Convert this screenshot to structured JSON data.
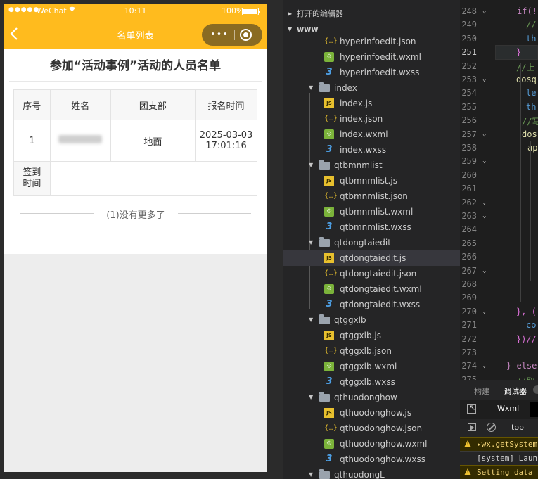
{
  "statusbar": {
    "signal": "●●●●●",
    "carrier": "WeChat",
    "wifi_icon": "wifi-icon",
    "time": "10:11",
    "battery_pct": "100%"
  },
  "navbar": {
    "back_glyph": "‹",
    "title": "名单列表",
    "more_glyph": "•••"
  },
  "page": {
    "heading": "参加“活动事例”活动的人员名单",
    "table": {
      "headers": [
        "序号",
        "姓名",
        "团支部",
        "报名时间"
      ],
      "rows": [
        {
          "index": "1",
          "branch": "地面",
          "time_line1": "2025-03-03",
          "time_line2": "17:01:16"
        }
      ],
      "signin_label_line1": "签到",
      "signin_label_line2": "时间"
    },
    "no_more": "(1)没有更多了"
  },
  "tree": {
    "section_open_editors": "打开的编辑器",
    "section_root": "www",
    "items": [
      {
        "type": "wxml-icon",
        "name": "hyperinfoedit.json",
        "kind": "json"
      },
      {
        "type": "wxml",
        "name": "hyperinfoedit.wxml",
        "kind": "wxml"
      },
      {
        "type": "wxss",
        "name": "hyperinfoedit.wxss",
        "kind": "wxss"
      },
      {
        "type": "folder",
        "name": "index",
        "kind": "folder"
      },
      {
        "type": "js",
        "name": "index.js",
        "kind": "js"
      },
      {
        "type": "json",
        "name": "index.json",
        "kind": "json"
      },
      {
        "type": "wxml",
        "name": "index.wxml",
        "kind": "wxml"
      },
      {
        "type": "wxss",
        "name": "index.wxss",
        "kind": "wxss"
      },
      {
        "type": "folder",
        "name": "qtbmnmlist",
        "kind": "folder"
      },
      {
        "type": "js",
        "name": "qtbmnmlist.js",
        "kind": "js"
      },
      {
        "type": "json",
        "name": "qtbmnmlist.json",
        "kind": "json"
      },
      {
        "type": "wxml",
        "name": "qtbmnmlist.wxml",
        "kind": "wxml"
      },
      {
        "type": "wxss",
        "name": "qtbmnmlist.wxss",
        "kind": "wxss"
      },
      {
        "type": "folder",
        "name": "qtdongtaiedit",
        "kind": "folder"
      },
      {
        "type": "js",
        "name": "qtdongtaiedit.js",
        "kind": "js"
      },
      {
        "type": "json",
        "name": "qtdongtaiedit.json",
        "kind": "json"
      },
      {
        "type": "wxml",
        "name": "qtdongtaiedit.wxml",
        "kind": "wxml"
      },
      {
        "type": "wxss",
        "name": "qtdongtaiedit.wxss",
        "kind": "wxss"
      },
      {
        "type": "folder",
        "name": "qtggxlb",
        "kind": "folder"
      },
      {
        "type": "js",
        "name": "qtggxlb.js",
        "kind": "js"
      },
      {
        "type": "json",
        "name": "qtggxlb.json",
        "kind": "json"
      },
      {
        "type": "wxml",
        "name": "qtggxlb.wxml",
        "kind": "wxml"
      },
      {
        "type": "wxss",
        "name": "qtggxlb.wxss",
        "kind": "wxss"
      },
      {
        "type": "folder",
        "name": "qthuodonghow",
        "kind": "folder"
      },
      {
        "type": "js",
        "name": "qthuodonghow.js",
        "kind": "js"
      },
      {
        "type": "json",
        "name": "qthuodonghow.json",
        "kind": "json"
      },
      {
        "type": "wxml",
        "name": "qthuodonghow.wxml",
        "kind": "wxml"
      },
      {
        "type": "wxss",
        "name": "qthuodonghow.wxss",
        "kind": "wxss"
      },
      {
        "type": "folder",
        "name": "qthuodongL",
        "kind": "folder"
      }
    ],
    "selected": "qtdongtaiedit.js"
  },
  "editor": {
    "lines": [
      "248",
      "249",
      "250",
      "251",
      "252",
      "253",
      "254",
      "255",
      "256",
      "257",
      "258",
      "259",
      "260",
      "261",
      "262",
      "263",
      "264",
      "265",
      "266",
      "267",
      "268",
      "269",
      "270",
      "271",
      "272",
      "273",
      "274",
      "275"
    ],
    "current_line": "251",
    "code": {
      "l248": "if(!",
      "l249": "//",
      "l250": "th",
      "l251": "}",
      "l252": "//上",
      "l253": "dosq",
      "l254": "le",
      "l255": "th",
      "l256": "//写",
      "l257": "dos",
      "l258": "ap",
      "l270": "}, (",
      "l271": "co",
      "l272": "})//",
      "l274": "} else",
      "l275": "//取"
    }
  },
  "debug": {
    "tab_build": "构建",
    "tab_debugger": "调试器",
    "tab_wxml": "Wxml",
    "context": "top",
    "console": [
      {
        "level": "warn",
        "text": "▸wx.getSystem"
      },
      {
        "level": "info",
        "text": "[system] Laun"
      },
      {
        "level": "warn",
        "text": "Setting data"
      }
    ]
  }
}
